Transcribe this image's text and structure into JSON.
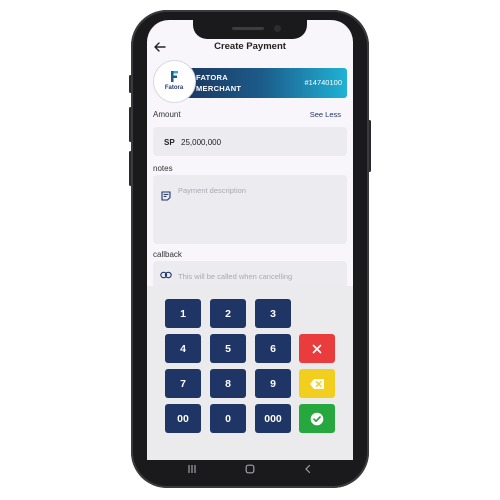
{
  "header": {
    "title": "Create Payment"
  },
  "merchant": {
    "logo_text": "Fatora",
    "name_line1": "FATORA",
    "name_line2": "MERCHANT",
    "id": "#14740100"
  },
  "form": {
    "amount_label": "Amount",
    "see_less": "See Less",
    "currency": "SP",
    "amount_value": "25,000,000",
    "notes_label": "notes",
    "notes_placeholder": "Payment description",
    "callback_label": "callback",
    "callback_placeholder": "This will be called when cancelling"
  },
  "keypad": {
    "keys": [
      "1",
      "2",
      "3",
      "4",
      "5",
      "6",
      "7",
      "8",
      "9",
      "00",
      "0",
      "000"
    ],
    "clear_icon": "close-icon",
    "backspace_icon": "backspace-icon",
    "confirm_icon": "check-circle-icon"
  },
  "colors": {
    "key_blue": "#1f3566",
    "clear_red": "#e93d3d",
    "backspace_yellow": "#f2cf1f",
    "confirm_green": "#27a83f"
  }
}
